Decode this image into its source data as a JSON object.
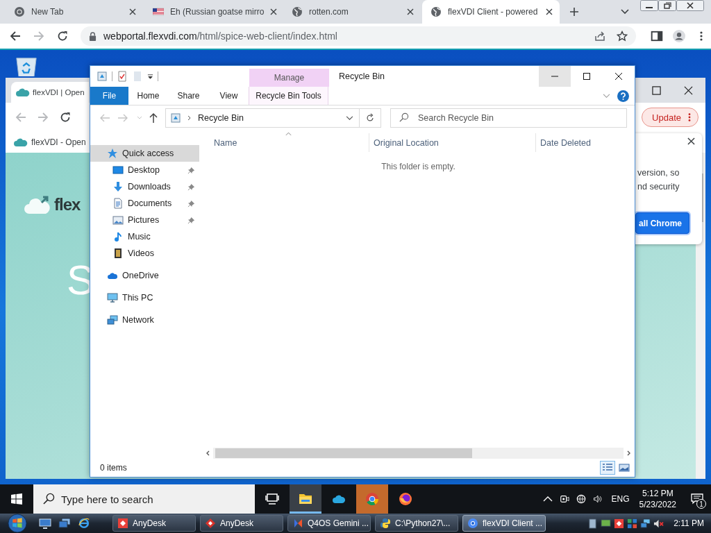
{
  "browser": {
    "tabs": [
      {
        "title": "New Tab",
        "kind": "chrome",
        "selected": false
      },
      {
        "title": "Eh (Russian goatse mirro",
        "kind": "flag",
        "selected": false
      },
      {
        "title": "rotten.com",
        "kind": "globe",
        "selected": false
      },
      {
        "title": "flexVDI Client - powered",
        "kind": "globe",
        "selected": true
      }
    ],
    "url_host": "webportal.flexvdi.com",
    "url_path": "/html/spice-web-client/index.html"
  },
  "remote": {
    "background_window": {
      "tab_title": "flexVDI | Open",
      "update_button": "Update",
      "bookmark": "flexVDI - Open",
      "logo_text": "flex",
      "heading": "S",
      "popup": {
        "lines": [
          "version, so",
          "nd security"
        ],
        "button": "all Chrome"
      }
    },
    "explorer": {
      "context_tab": "Manage",
      "title": "Recycle Bin",
      "ribbon_tabs": [
        {
          "label": "File",
          "kind": "file"
        },
        {
          "label": "Home",
          "kind": "tab"
        },
        {
          "label": "Share",
          "kind": "tab"
        },
        {
          "label": "View",
          "kind": "tab"
        },
        {
          "label": "Recycle Bin Tools",
          "kind": "context"
        }
      ],
      "location": "Recycle Bin",
      "search": {
        "placeholder": "Search Recycle Bin"
      },
      "nav": [
        {
          "label": "Quick access",
          "kind": "star",
          "selected": true,
          "children": [
            {
              "label": "Desktop",
              "kind": "desktop",
              "pinned": true,
              "selected": false
            },
            {
              "label": "Downloads",
              "kind": "download",
              "pinned": true,
              "selected": false
            },
            {
              "label": "Documents",
              "kind": "documents",
              "pinned": true,
              "selected": false
            },
            {
              "label": "Pictures",
              "kind": "pictures",
              "pinned": true,
              "selected": false
            },
            {
              "label": "Music",
              "kind": "music",
              "pinned": false,
              "selected": false
            },
            {
              "label": "Videos",
              "kind": "videos",
              "pinned": false,
              "selected": false
            }
          ]
        },
        {
          "label": "OneDrive",
          "kind": "cloud",
          "selected": false
        },
        {
          "label": "This PC",
          "kind": "pc",
          "selected": false
        },
        {
          "label": "Network",
          "kind": "network",
          "selected": false
        }
      ],
      "columns": [
        {
          "label": "Name",
          "sorted": true
        },
        {
          "label": "Original Location",
          "sorted": false
        },
        {
          "label": "Date Deleted",
          "sorted": false
        }
      ],
      "empty_message": "This folder is empty.",
      "status": "0 items",
      "views": [
        {
          "kind": "details",
          "selected": true
        },
        {
          "kind": "large-icons",
          "selected": false
        }
      ]
    },
    "taskbar": {
      "search": {
        "placeholder": "Type here to search"
      },
      "apps": [
        {
          "kind": "task-view",
          "active": false,
          "flashing": false
        },
        {
          "kind": "explorer",
          "active": true,
          "flashing": false
        },
        {
          "kind": "onedrive",
          "active": false,
          "flashing": false
        },
        {
          "kind": "chrome",
          "active": false,
          "flashing": true
        },
        {
          "kind": "firefox",
          "active": false,
          "flashing": false
        }
      ],
      "language": "ENG",
      "time": "5:12 PM",
      "date": "5/23/2022",
      "notifications": "1"
    }
  },
  "host_taskbar": {
    "items": [
      {
        "label": "AnyDesk",
        "kind": "anydesk",
        "active": false
      },
      {
        "label": "AnyDesk",
        "kind": "anydesk-alt",
        "active": false
      },
      {
        "label": "Q4OS Gemini ...",
        "kind": "q4os",
        "active": false
      },
      {
        "label": "C:\\Python27\\...",
        "kind": "python",
        "active": false
      },
      {
        "label": "flexVDI Client ...",
        "kind": "chrome",
        "active": true
      }
    ],
    "time": "2:11 PM"
  }
}
